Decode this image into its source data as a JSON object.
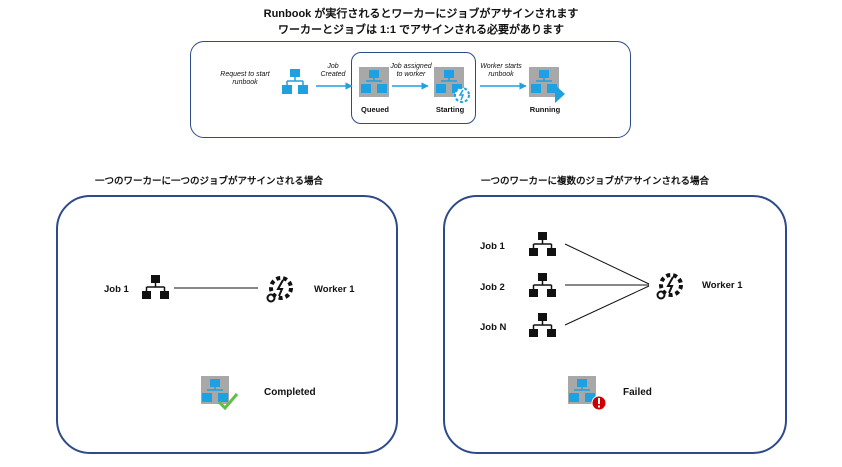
{
  "header": {
    "line1": "Runbook が実行されるとワーカーにジョブがアサインされます",
    "line2": "ワーカーとジョブは 1:1 でアサインされる必要があります"
  },
  "flow": {
    "request_label": "Request to start runbook",
    "job_created_label": "Job Created",
    "job_assigned_label": "Job assigned to worker",
    "worker_starts_label": "Worker starts runbook",
    "queued_label": "Queued",
    "starting_label": "Starting",
    "running_label": "Running"
  },
  "left_panel": {
    "title": "一つのワーカーに一つのジョブがアサインされる場合",
    "job_label": "Job 1",
    "worker_label": "Worker 1",
    "status_label": "Completed"
  },
  "right_panel": {
    "title": "一つのワーカーに複数のジョブがアサインされる場合",
    "jobs": [
      "Job 1",
      "Job 2",
      "Job N"
    ],
    "worker_label": "Worker 1",
    "status_label": "Failed"
  },
  "colors": {
    "border": "#2d4a8a",
    "blue": "#1ea1e1",
    "gray": "#a8a8a8",
    "success": "#5cc146",
    "error": "#cc0000"
  }
}
